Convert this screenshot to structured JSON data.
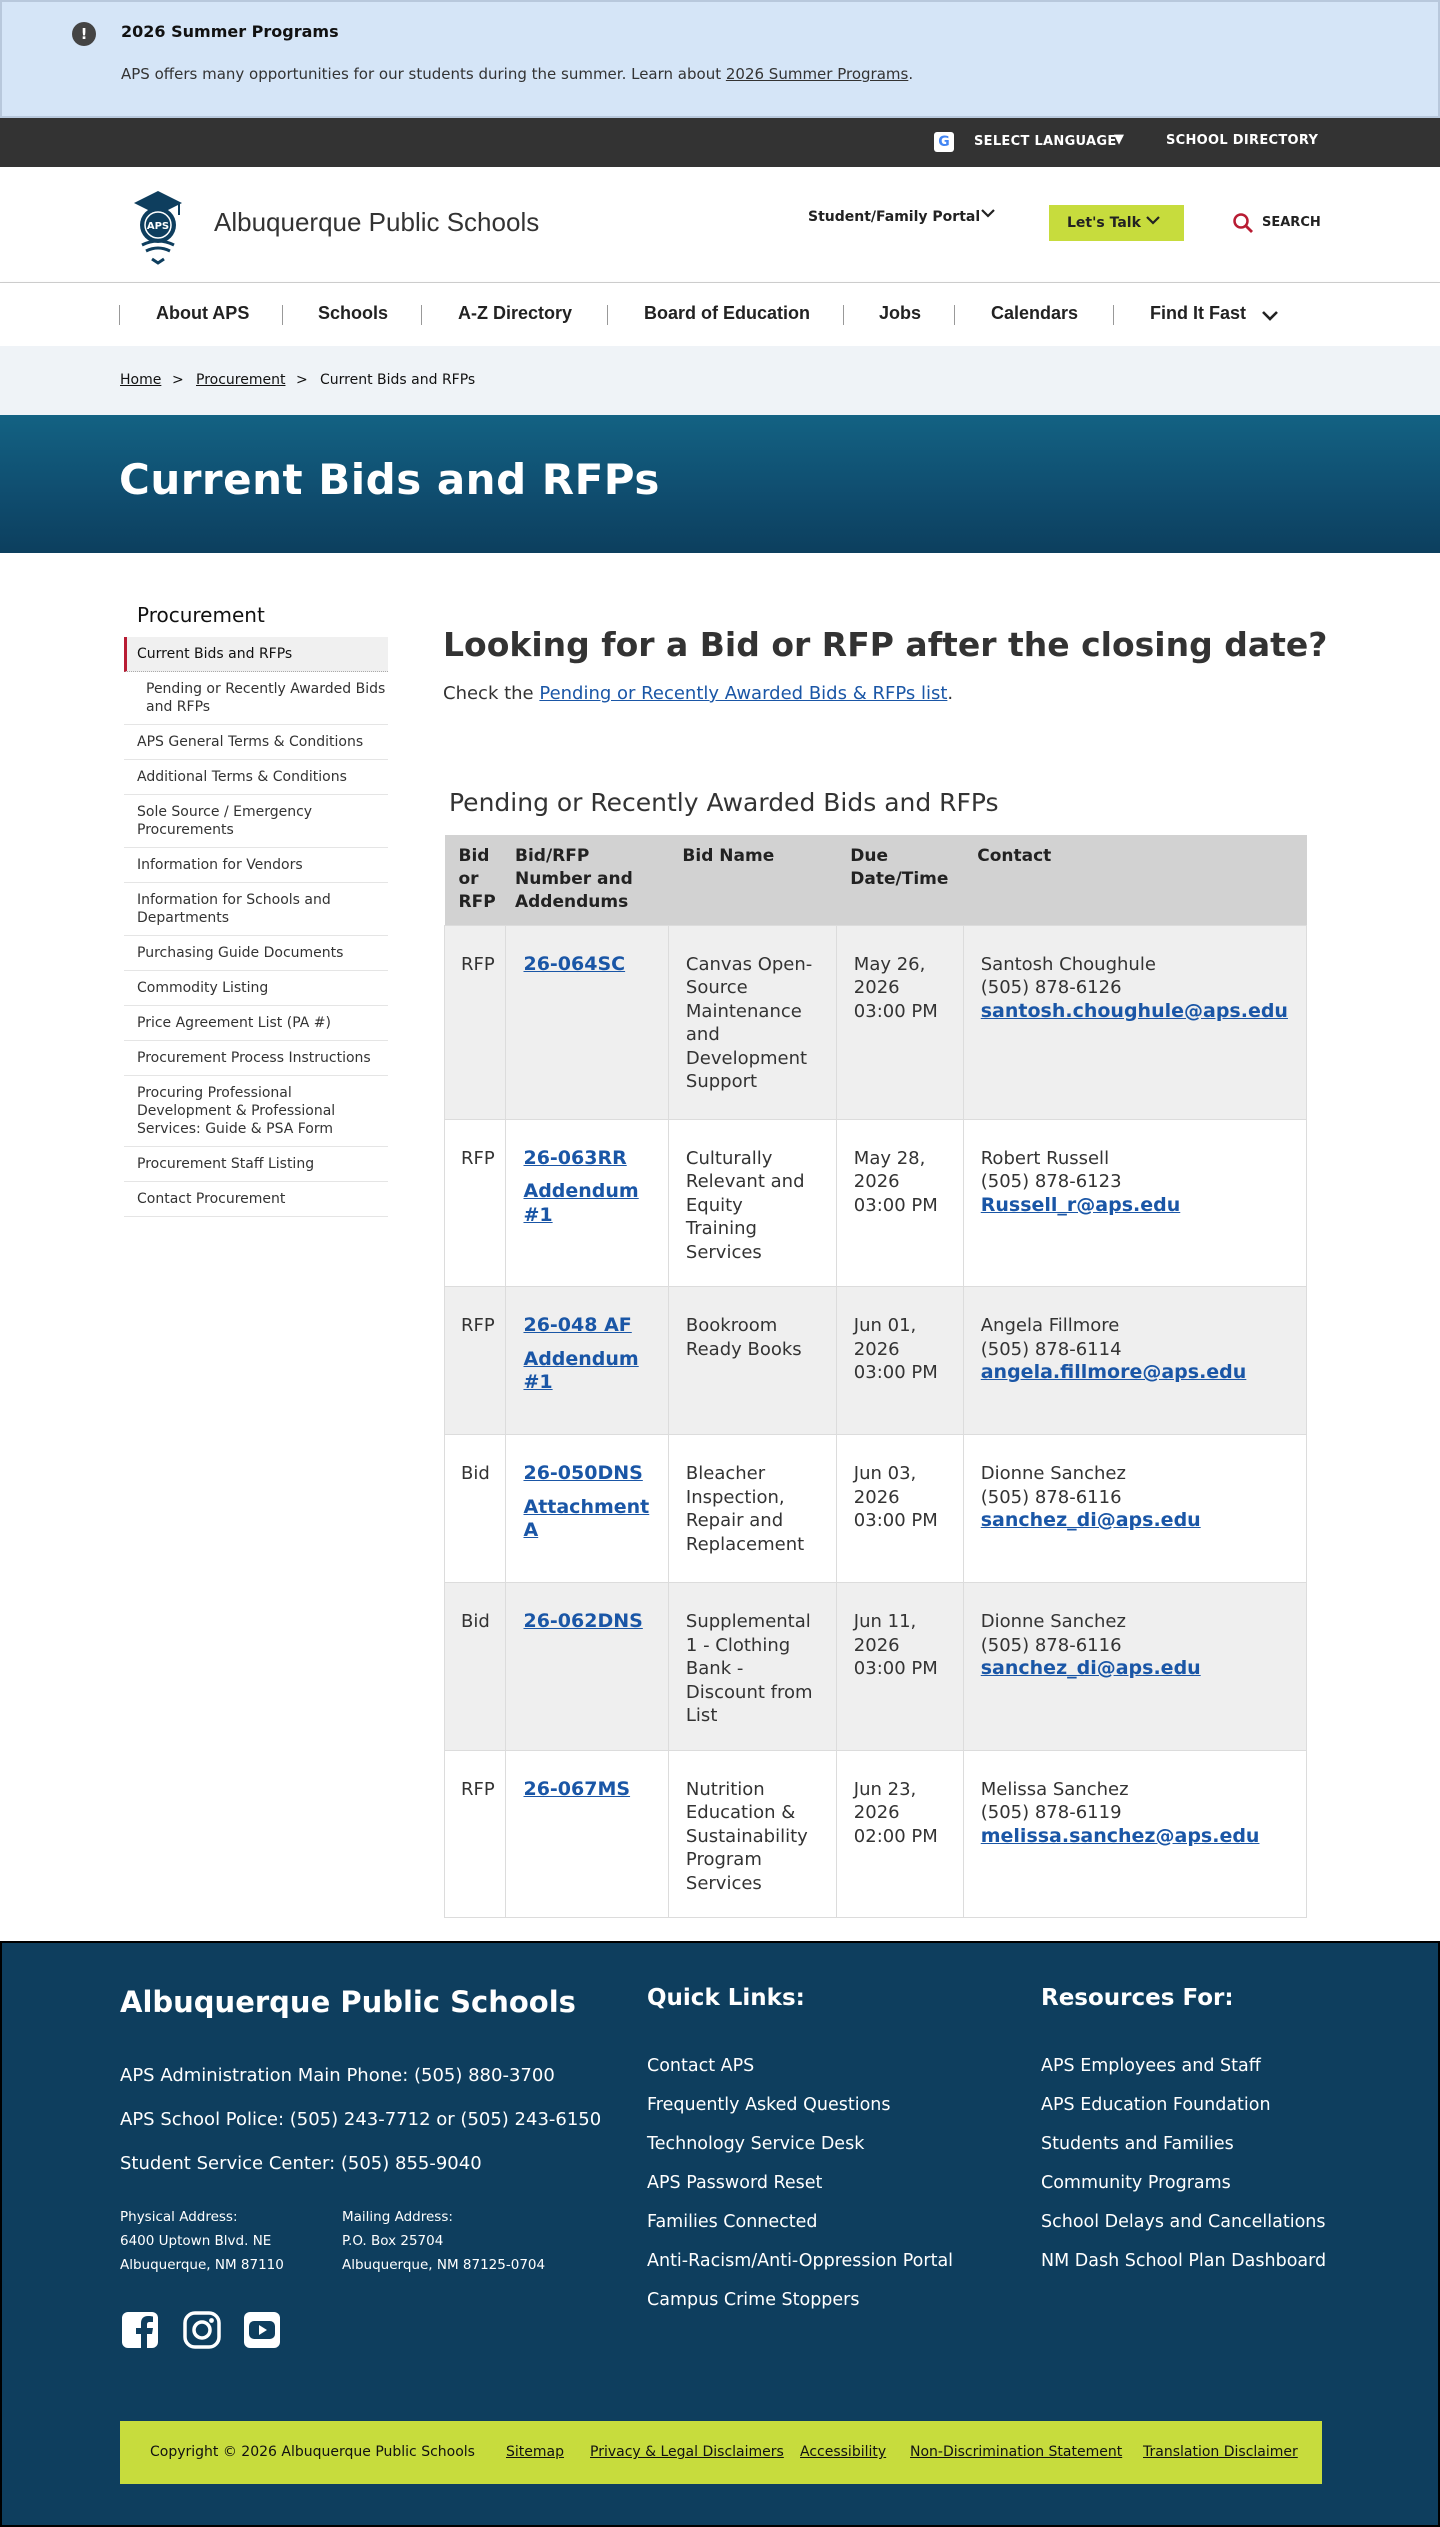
{
  "alert": {
    "title": "2026 Summer Programs",
    "text_before": "APS offers many opportunities for our students during the summer. Learn about ",
    "link": "2026 Summer Programs",
    "text_after": "."
  },
  "utility": {
    "language": "SELECT LANGUAGE",
    "language_caret": "▼",
    "school_directory": "SCHOOL DIRECTORY"
  },
  "header": {
    "site_name": "Albuquerque Public Schools",
    "logo_text": "APS",
    "portal": "Student/Family Portal",
    "talk": "Let's Talk",
    "search": "SEARCH"
  },
  "nav": {
    "items": [
      "About APS",
      "Schools",
      "A-Z Directory",
      "Board of Education",
      "Jobs",
      "Calendars",
      "Find It Fast"
    ]
  },
  "breadcrumb": {
    "items": [
      "Home",
      "Procurement",
      "Current Bids and RFPs"
    ],
    "separator": ">"
  },
  "hero": {
    "title": "Current Bids and RFPs"
  },
  "sidebar": {
    "title": "Procurement",
    "items": [
      "Current Bids and RFPs",
      "Pending or Recently Awarded Bids and RFPs",
      "APS General Terms & Conditions",
      "Additional Terms & Conditions",
      "Sole Source / Emergency Procurements",
      "Information for Vendors",
      "Information for Schools and Departments",
      "Purchasing Guide Documents",
      "Commodity Listing",
      "Price Agreement List (PA #)",
      "Procurement Process Instructions",
      "Procuring Professional Development & Professional Services: Guide & PSA Form",
      "Procurement Staff Listing",
      "Contact Procurement"
    ]
  },
  "main": {
    "heading": "Looking for a Bid or RFP after the closing date?",
    "check_before": "Check the ",
    "check_link": "Pending or Recently Awarded Bids & RFPs list",
    "check_after": ".",
    "table_title": "Pending or Recently Awarded Bids and RFPs",
    "columns": [
      "Bid or RFP",
      "Bid/RFP Number and Addendums",
      "Bid Name",
      "Due Date/Time",
      "Contact"
    ],
    "rows": [
      {
        "type": "RFP",
        "number": "26-064SC",
        "addendum": "",
        "name": "Canvas Open-Source Maintenance and Development Support",
        "due": "May 26, 2026 03:00 PM",
        "contact_name": "Santosh Choughule",
        "phone": "(505) 878-6126",
        "email": "santosh.choughule@aps.edu"
      },
      {
        "type": "RFP",
        "number": "26-063RR",
        "addendum": "Addendum #1",
        "name": "Culturally Relevant and Equity Training Services",
        "due": "May 28, 2026 03:00 PM",
        "contact_name": "Robert Russell",
        "phone": "(505) 878-6123",
        "email": "Russell_r@aps.edu"
      },
      {
        "type": "RFP",
        "number": "26-048 AF",
        "addendum": "Addendum #1",
        "name": "Bookroom Ready Books",
        "due": "Jun 01, 2026 03:00 PM",
        "contact_name": "Angela Fillmore",
        "phone": "(505) 878-6114",
        "email": "angela.fillmore@aps.edu"
      },
      {
        "type": "Bid",
        "number": "26-050DNS",
        "addendum": "Attachment A",
        "name": "Bleacher Inspection, Repair and Replacement",
        "due": "Jun 03, 2026 03:00 PM",
        "contact_name": "Dionne Sanchez",
        "phone": "(505) 878-6116",
        "email": "sanchez_di@aps.edu"
      },
      {
        "type": "Bid",
        "number": "26-062DNS",
        "addendum": "",
        "name": "Supplemental 1 - Clothing Bank - Discount from List",
        "due": "Jun 11, 2026 03:00 PM",
        "contact_name": "Dionne Sanchez",
        "phone": "(505) 878-6116",
        "email": "sanchez_di@aps.edu"
      },
      {
        "type": "RFP",
        "number": "26-067MS",
        "addendum": "",
        "name": "Nutrition Education & Sustainability Program Services",
        "due": "Jun 23, 2026 02:00 PM",
        "contact_name": "Melissa Sanchez",
        "phone": "(505) 878-6119",
        "email": "melissa.sanchez@aps.edu"
      }
    ]
  },
  "footer": {
    "name": "Albuquerque Public Schools",
    "main_phone": "APS Administration Main Phone: (505) 880-3700",
    "police": "APS School Police: (505) 243-7712 or (505) 243-6150",
    "service": "Student Service Center: (505) 855-9040",
    "physical_label": "Physical Address:",
    "physical_line1": "6400 Uptown Blvd. NE",
    "physical_line2": "Albuquerque, NM 87110",
    "mailing_label": "Mailing Address:",
    "mailing_line1": "P.O. Box 25704",
    "mailing_line2": "Albuquerque, NM 87125-0704",
    "quick_title": "Quick Links:",
    "quick_links": [
      "Contact APS",
      "Frequently Asked Questions",
      "Technology Service Desk",
      "APS Password Reset",
      "Families Connected",
      "Anti-Racism/Anti-Oppression Portal",
      "Campus Crime Stoppers"
    ],
    "resources_title": "Resources For:",
    "resources_links": [
      "APS Employees and Staff",
      "APS Education Foundation",
      "Students and Families",
      "Community Programs",
      "School Delays and Cancellations",
      "NM Dash School Plan Dashboard"
    ],
    "copyright": "Copyright © 2026 Albuquerque Public Schools",
    "bottom_links": [
      "Sitemap",
      "Privacy & Legal Disclaimers",
      "Accessibility",
      "Non-Discrimination Statement",
      "Translation Disclaimer"
    ]
  },
  "colors": {
    "alert_bg": "#d5e5f7",
    "utility_bg": "#333333",
    "accent_green": "#c7dc3d",
    "hero_blue": "#0f4c6e",
    "link_blue": "#1a56a6",
    "footer_bg": "#0e3e5e",
    "active_red": "#b81c33"
  },
  "icons": {
    "alert": "exclamation-circle-icon",
    "language": "google-translate-icon",
    "search": "magnifier-icon",
    "social": [
      "facebook-icon",
      "instagram-icon",
      "youtube-icon"
    ]
  }
}
